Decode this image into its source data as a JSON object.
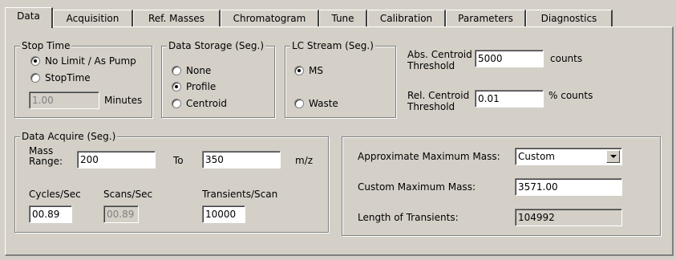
{
  "tabs": [
    "Data",
    "Acquisition",
    "Ref. Masses",
    "Chromatogram",
    "Tune",
    "Calibration",
    "Parameters",
    "Diagnostics"
  ],
  "active_tab": "Data",
  "stop_time": {
    "title": "Stop Time",
    "options": [
      "No Limit / As Pump",
      "StopTime"
    ],
    "selected": "No Limit / As Pump",
    "value": "1.00",
    "unit": "Minutes"
  },
  "data_storage": {
    "title": "Data Storage (Seg.)",
    "options": [
      "None",
      "Profile",
      "Centroid"
    ],
    "selected": "Profile"
  },
  "lc_stream": {
    "title": "LC Stream (Seg.)",
    "options": [
      "MS",
      "Waste"
    ],
    "selected": "MS"
  },
  "thresholds": {
    "abs_label_line1": "Abs. Centroid",
    "abs_label_line2": "Threshold",
    "abs_value": "5000",
    "abs_unit": "counts",
    "rel_label_line1": "Rel. Centroid",
    "rel_label_line2": "Threshold",
    "rel_value": "0.01",
    "rel_unit": "% counts"
  },
  "data_acquire": {
    "title": "Data Acquire (Seg.)",
    "mass_range_line1": "Mass",
    "mass_range_line2": "Range:",
    "mass_from": "200",
    "to_label": "To",
    "mass_to": "350",
    "mz_unit": "m/z",
    "cycles_label": "Cycles/Sec",
    "cycles_value": "00.89",
    "scans_label": "Scans/Sec",
    "scans_value": "00.89",
    "transients_label": "Transients/Scan",
    "transients_value": "10000"
  },
  "max_mass": {
    "approx_label": "Approximate Maximum Mass:",
    "approx_value": "Custom",
    "custom_label": "Custom Maximum Mass:",
    "custom_value": "3571.00",
    "transients_label": "Length of Transients:",
    "transients_value": "104992"
  },
  "colors": {
    "face": "#d4d0c8",
    "shadow": "#808080",
    "highlight": "#ffffff",
    "dark_shadow": "#404040",
    "disabled_text": "#808080"
  }
}
